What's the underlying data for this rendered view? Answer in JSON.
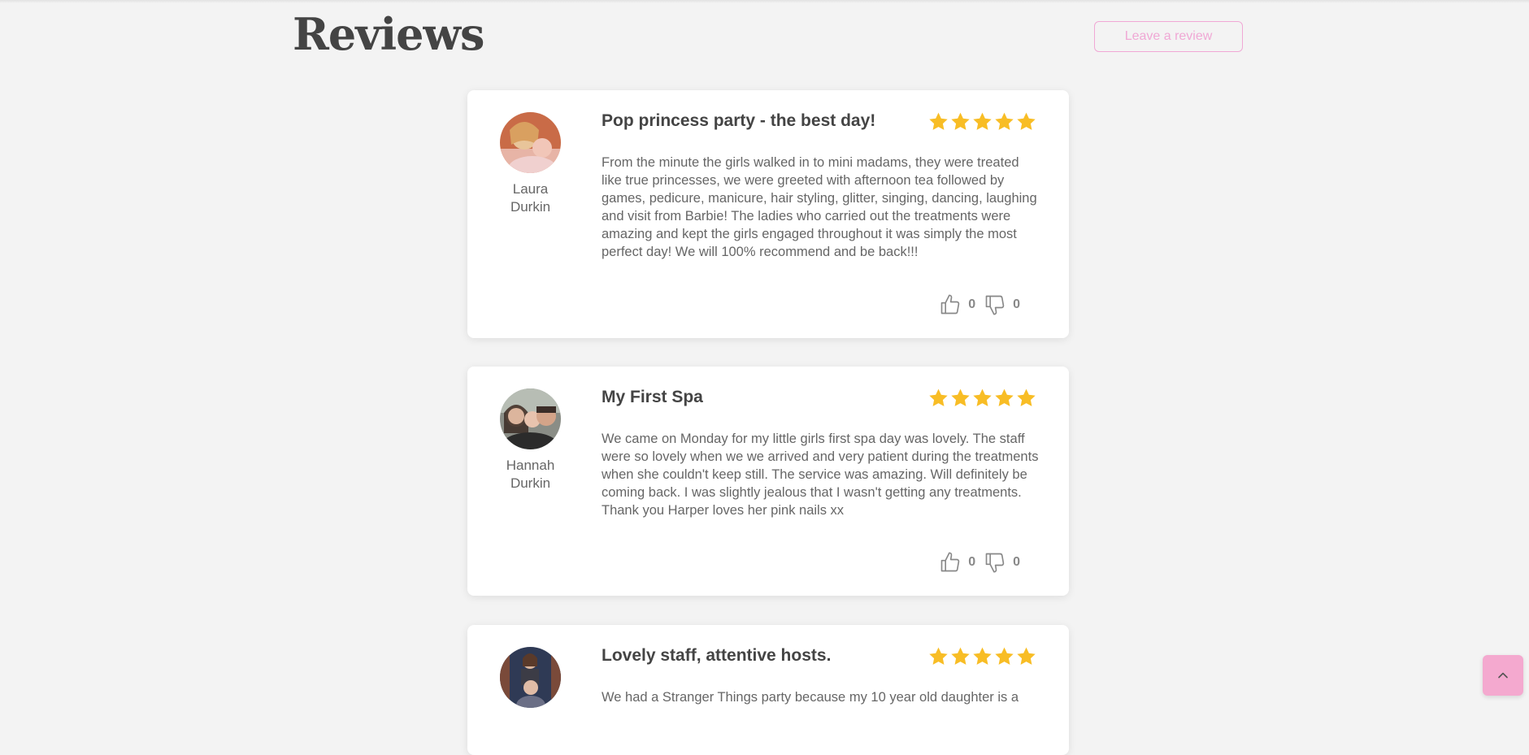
{
  "page": {
    "title": "Reviews",
    "leave_review_label": "Leave a review",
    "accent_color": "#f0a8d5",
    "star_color": "#f8bd25"
  },
  "reviews": [
    {
      "author_first": "Laura",
      "author_last": "Durkin",
      "title": "Pop princess party - the best day!",
      "rating": 5,
      "body": "From the minute the girls walked in to mini madams, they were treated like true princesses, we were greeted with afternoon tea followed by games, pedicure, manicure, hair styling, glitter, singing, dancing, laughing and visit from Barbie! The ladies who carried out the treatments were amazing and kept the girls engaged throughout it was simply the most perfect day! We will 100% recommend and be back!!!",
      "likes": "0",
      "dislikes": "0"
    },
    {
      "author_first": "Hannah",
      "author_last": "Durkin",
      "title": "My First Spa",
      "rating": 5,
      "body": "We came on Monday for my little girls first spa day was lovely. The staff were so lovely when we we arrived and very patient during the treatments when she couldn't keep still. The service was amazing. Will definitely be coming back. I was slightly jealous that I wasn't getting any treatments. Thank you Harper loves her pink nails xx",
      "likes": "0",
      "dislikes": "0"
    },
    {
      "title": "Lovely staff, attentive hosts.",
      "rating": 5,
      "body": "We had a Stranger Things party because my 10 year old daughter is a"
    }
  ],
  "icons": {
    "star": "star-icon",
    "like": "thumbs-up-icon",
    "dislike": "thumbs-down-icon",
    "scroll_top": "chevron-up-icon"
  }
}
